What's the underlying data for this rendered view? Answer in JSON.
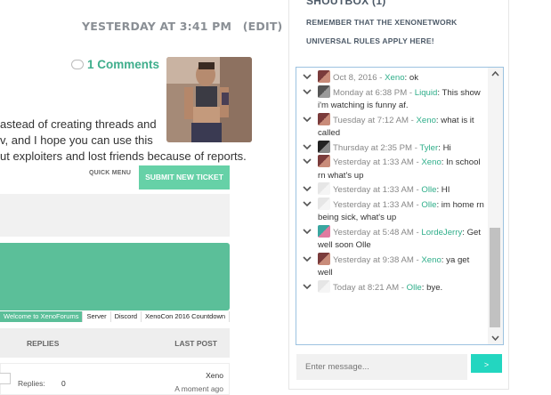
{
  "post": {
    "timestamp": "YESTERDAY AT 3:41 PM",
    "edit_label": "(EDIT)",
    "comments_label": "1 Comments",
    "body_lines": [
      "astead of creating threads and",
      "v, and I hope you can use this",
      "ut exploiters and lost friends because of reports."
    ]
  },
  "actions": {
    "quick_menu": "QUICK MENU",
    "submit_ticket": "SUBMIT NEW TICKET"
  },
  "tabs": [
    "Welcome to XenoForums",
    "Server",
    "Discord",
    "XenoCon 2016 Countdown"
  ],
  "table": {
    "col_replies": "REPLIES",
    "col_last_post": "LAST POST",
    "row": {
      "replies_label": "Replies:",
      "replies_value": "0",
      "last_poster": "Xeno",
      "last_time": "A moment ago"
    }
  },
  "shoutbox": {
    "title": "SHOUTBOX (1)",
    "notice": "REMEMBER THAT THE XENONETWORK UNIVERSAL RULES APPLY HERE!",
    "input_placeholder": "Enter message...",
    "send_label": ">",
    "messages": [
      {
        "time": "Oct 8, 2016",
        "user": "Xeno",
        "text": "ok",
        "avatar": "xeno"
      },
      {
        "time": "Monday at 6:38 PM",
        "user": "Liquid",
        "text": "This show i'm watching is funny af.",
        "avatar": "liquid"
      },
      {
        "time": "Tuesday at 7:12 AM",
        "user": "Xeno",
        "text": "what is it called",
        "avatar": "xeno"
      },
      {
        "time": "Thursday at 2:35 PM",
        "user": "Tyler",
        "text": "Hi",
        "avatar": "tyler"
      },
      {
        "time": "Yesterday at 1:33 AM",
        "user": "Xeno",
        "text": "In school rn what's up",
        "avatar": "xeno"
      },
      {
        "time": "Yesterday at 1:33 AM",
        "user": "Olle",
        "text": "HI",
        "avatar": "olle"
      },
      {
        "time": "Yesterday at 1:33 AM",
        "user": "Olle",
        "text": "im home rn being sick, what's up",
        "avatar": "olle"
      },
      {
        "time": "Yesterday at 5:48 AM",
        "user": "LordeJerry",
        "text": "Get well soon Olle",
        "avatar": "lordejerry"
      },
      {
        "time": "Yesterday at 9:38 AM",
        "user": "Xeno",
        "text": "ya get well",
        "avatar": "xeno"
      },
      {
        "time": "Today at 8:21 AM",
        "user": "Olle",
        "text": "bye.",
        "avatar": "olle"
      }
    ]
  },
  "colors": {
    "accent_green": "#5bbf99",
    "button_green": "#66d1a7",
    "username": "#2fae8a",
    "send_button": "#23d6c0"
  }
}
